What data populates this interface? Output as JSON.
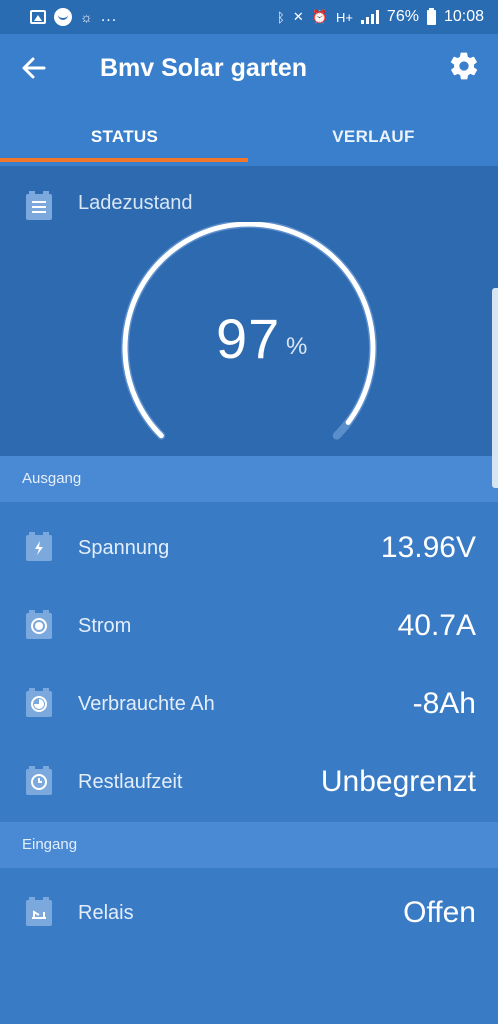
{
  "status_bar": {
    "dots": "...",
    "network": "H+",
    "battery": "76%",
    "time": "10:08"
  },
  "header": {
    "title": "Bmv Solar garten"
  },
  "tabs": [
    {
      "label": "STATUS",
      "active": true
    },
    {
      "label": "VERLAUF",
      "active": false
    }
  ],
  "gauge": {
    "label": "Ladezustand",
    "value": "97",
    "unit": "%",
    "fraction": 0.97
  },
  "sections": {
    "ausgang": "Ausgang",
    "eingang": "Eingang"
  },
  "rows": [
    {
      "label": "Spannung",
      "value": "13.96V",
      "icon": "bolt-icon"
    },
    {
      "label": "Strom",
      "value": "40.7A",
      "icon": "current-icon"
    },
    {
      "label": "Verbrauchte Ah",
      "value": "-8Ah",
      "icon": "consumed-icon"
    },
    {
      "label": "Restlaufzeit",
      "value": "Unbegrenzt",
      "icon": "clock-icon"
    },
    {
      "label": "Relais",
      "value": "Offen",
      "icon": "relay-icon"
    }
  ],
  "colors": {
    "accent": "#f0772b",
    "background": "#3a7bc6",
    "gauge_panel": "#2e6ab0"
  }
}
